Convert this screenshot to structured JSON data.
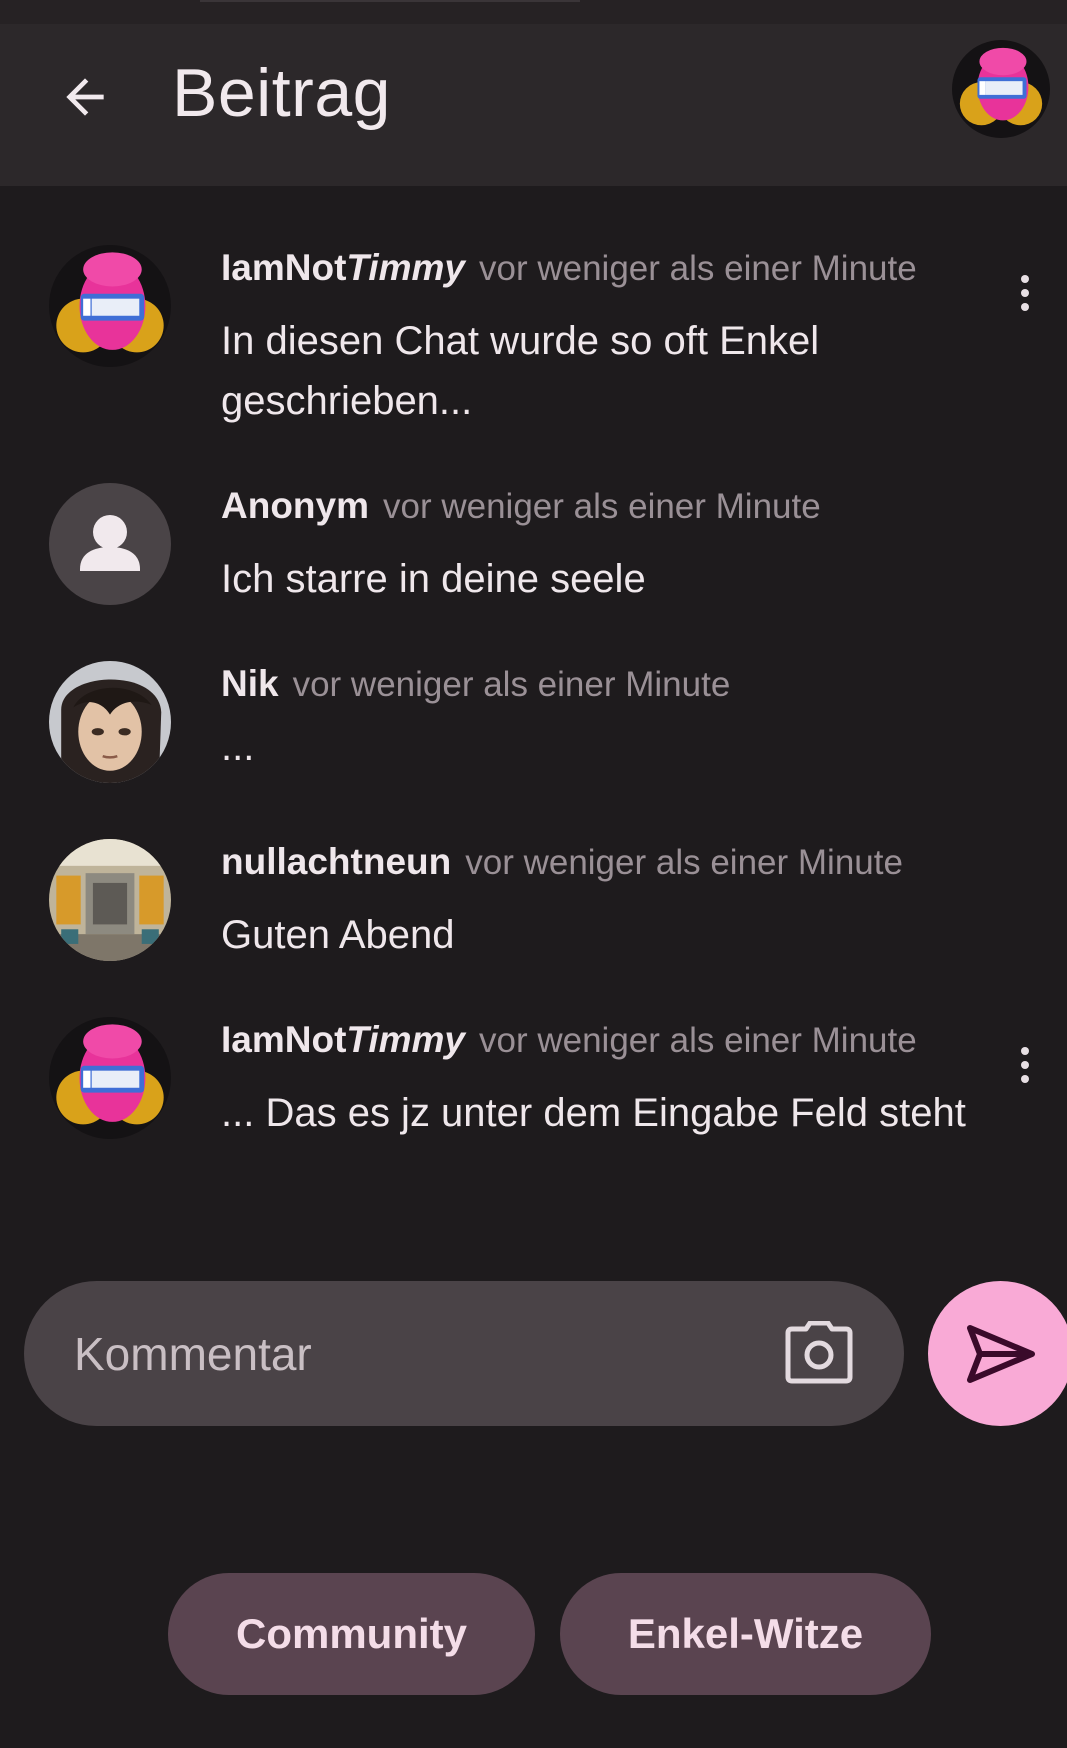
{
  "header": {
    "title": "Beitrag"
  },
  "comments": [
    {
      "user": "IamNot",
      "user_italic": "Timmy",
      "time": "vor weniger als einer Minute",
      "text": "In diesen Chat wurde so oft Enkel geschrieben..."
    },
    {
      "user": "Anonym",
      "user_italic": "",
      "time": "vor weniger als einer Minute",
      "text": "Ich starre in deine seele"
    },
    {
      "user": "Nik",
      "user_italic": "",
      "time": "vor weniger als einer Minute",
      "text": "..."
    },
    {
      "user": "nullachtneun",
      "user_italic": "",
      "time": "vor weniger als einer Minute",
      "text": "Guten Abend"
    },
    {
      "user": "IamNot",
      "user_italic": "Timmy",
      "time": "vor weniger als einer Minute",
      "text": "... Das es jz unter dem Eingabe Feld steht"
    }
  ],
  "composer": {
    "placeholder": "Kommentar"
  },
  "chips": [
    {
      "label": "Community"
    },
    {
      "label": "Enkel-Witze"
    }
  ],
  "colors": {
    "background": "#1e1b1d",
    "app_bar": "#2c282a",
    "input": "#4a4347",
    "send_button": "#f9aad6",
    "chip": "#5a4450",
    "timestamp": "#9a9096"
  }
}
